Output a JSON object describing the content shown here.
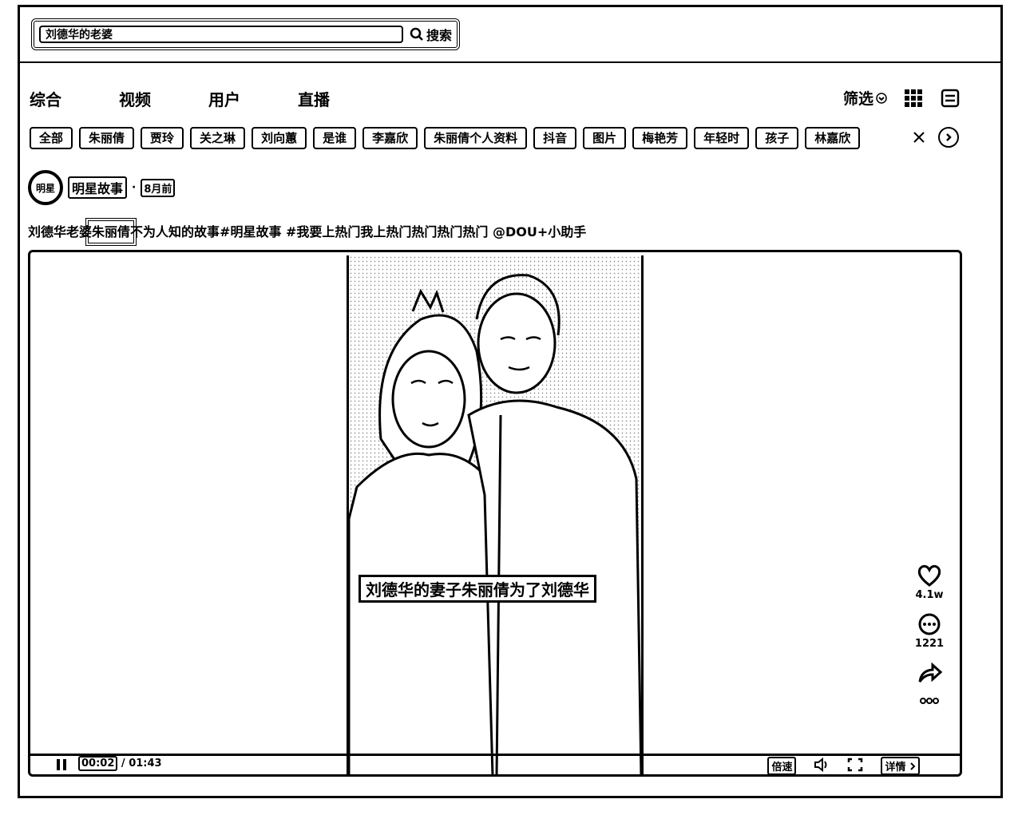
{
  "search": {
    "value": "刘德华的老婆",
    "button_label": "搜索"
  },
  "tabs": [
    "综合",
    "视频",
    "用户",
    "直播"
  ],
  "filter_label": "筛选",
  "chips": [
    "全部",
    "朱丽倩",
    "贾玲",
    "关之琳",
    "刘向蕙",
    "是谁",
    "李嘉欣",
    "朱丽倩个人资料",
    "抖音",
    "图片",
    "梅艳芳",
    "年轻时",
    "孩子",
    "林嘉欣"
  ],
  "post": {
    "avatar_text": "明星",
    "author": "明星故事",
    "separator": "·",
    "time": "8月前",
    "desc_prefix": "刘德华老婆",
    "desc_highlight": "朱丽倩",
    "desc_rest": "不为人知的故事#明星故事 #我要上热门我上热门热门热门热门 @DOU+小助手"
  },
  "video": {
    "subtitle": "刘德华的妻子朱丽倩为了刘德华",
    "likes": "4.1w",
    "comments": "1221",
    "current_time": "00:02",
    "separator": "/",
    "duration": "01:43",
    "speed_label": "倍速",
    "detail_label": "详情"
  }
}
